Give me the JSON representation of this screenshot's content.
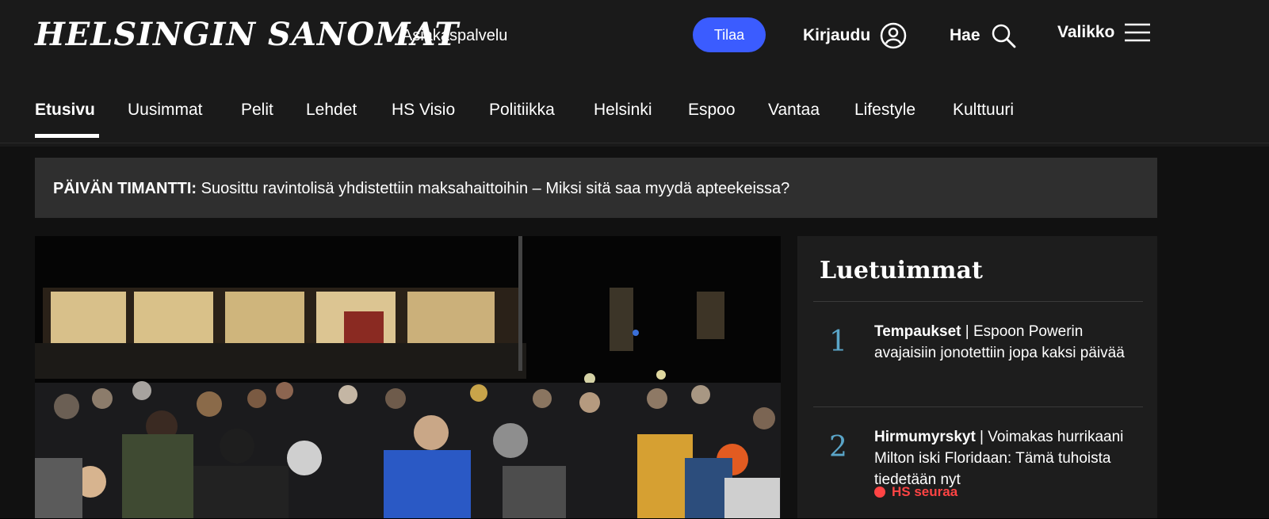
{
  "header": {
    "logo": "HELSINGIN SANOMAT",
    "customer_service": "Asiakaspalvelu",
    "subscribe": "Tilaa",
    "login": "Kirjaudu",
    "search": "Hae",
    "menu": "Valikko"
  },
  "nav": {
    "items": [
      {
        "label": "Etusivu",
        "active": true
      },
      {
        "label": "Uusimmat"
      },
      {
        "label": "Pelit"
      },
      {
        "label": "Lehdet"
      },
      {
        "label": "HS Visio"
      },
      {
        "label": "Politiikka"
      },
      {
        "label": "Helsinki"
      },
      {
        "label": "Espoo"
      },
      {
        "label": "Vantaa"
      },
      {
        "label": "Lifestyle"
      },
      {
        "label": "Kulttuuri"
      }
    ]
  },
  "diamond": {
    "label": "PÄIVÄN TIMANTTI:",
    "headline": "Suosittu ravintolisä yhdistettiin maksahaittoihin – Miksi sitä saa myydä apteekeissa?"
  },
  "most_read": {
    "title": "Luetuimmat",
    "items": [
      {
        "rank": "1",
        "tag": "Tempaukset",
        "separator": " | ",
        "headline": "Espoon Powerin avajaisiin jonotettiin jopa kaksi päivää"
      },
      {
        "rank": "2",
        "tag": "Hirmumyrskyt",
        "separator": " | ",
        "headline": "Voimakas hurrikaani Milton iski Floridaan: Tämä tuhoista tiedetään nyt",
        "source": "HS seuraa"
      }
    ]
  },
  "colors": {
    "accent": "#3b5cff",
    "rank_number": "#5aa5c8",
    "live_source": "#ff4444"
  }
}
